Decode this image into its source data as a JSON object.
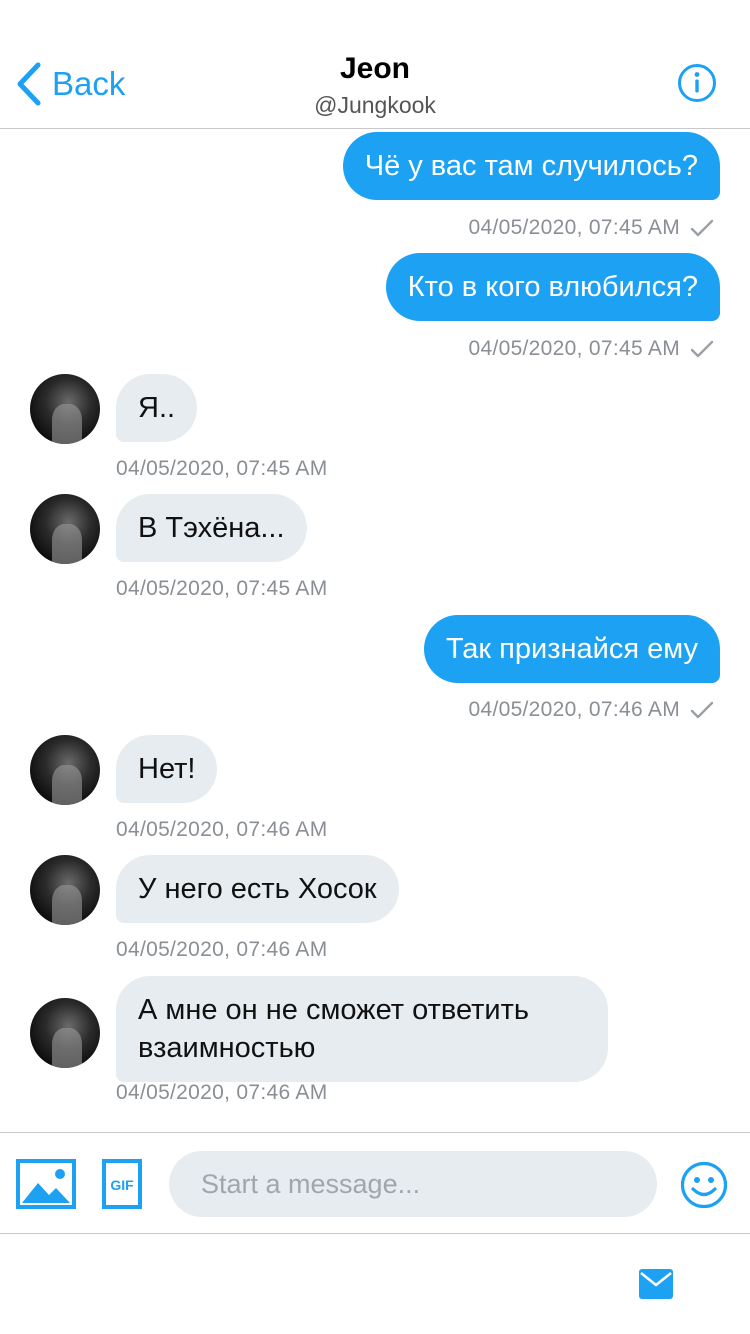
{
  "header": {
    "back_label": "Back",
    "title": "Jeon",
    "subtitle": "@Jungkook"
  },
  "messages": [
    {
      "side": "out",
      "text": "Чё у вас там случилось?",
      "time": "04/05/2020, 07:45 AM"
    },
    {
      "side": "out",
      "text": "Кто в кого влюбился?",
      "time": "04/05/2020, 07:45 AM"
    },
    {
      "side": "in",
      "text": "Я..",
      "time": "04/05/2020, 07:45 AM"
    },
    {
      "side": "in",
      "text": "В Тэхёна...",
      "time": "04/05/2020, 07:45 AM"
    },
    {
      "side": "out",
      "text": "Так признайся ему",
      "time": "04/05/2020, 07:46 AM"
    },
    {
      "side": "in",
      "text": "Нет!",
      "time": "04/05/2020, 07:46 AM"
    },
    {
      "side": "in",
      "text": "У него есть Хосок",
      "time": "04/05/2020, 07:46 AM"
    },
    {
      "side": "in",
      "text": "А мне он не сможет ответить взаимностью",
      "time": "04/05/2020, 07:46 AM"
    }
  ],
  "composer": {
    "placeholder": "Start a message...",
    "gif_label": "GIF"
  },
  "icons": {
    "back": "chevron-left-icon",
    "info": "info-icon",
    "media": "image-icon",
    "gif": "gif-icon",
    "emoji": "smiley-icon",
    "mail": "envelope-icon",
    "read": "checkmark-icon"
  },
  "colors": {
    "accent": "#1da1f2",
    "incoming_bubble": "#e6ecf0",
    "timestamp": "#8a8f95"
  }
}
